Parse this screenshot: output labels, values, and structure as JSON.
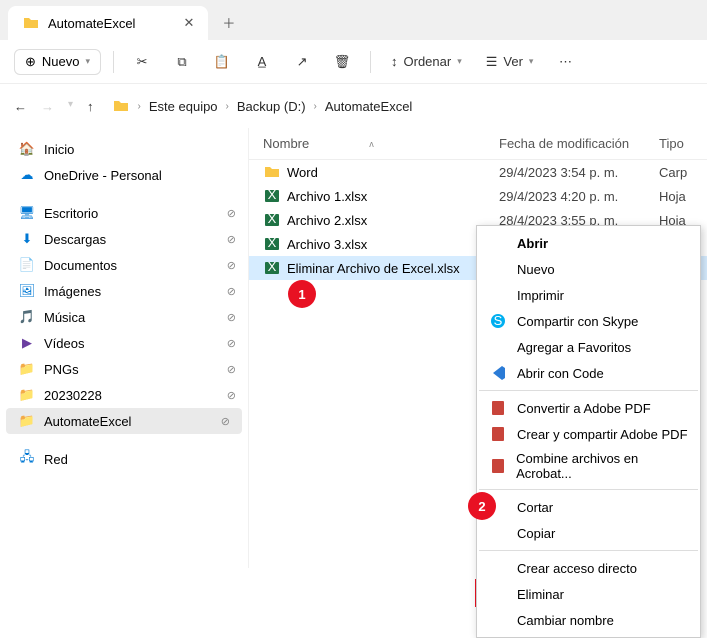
{
  "tab": {
    "title": "AutomateExcel"
  },
  "toolbar": {
    "new": "Nuevo",
    "sort": "Ordenar",
    "view": "Ver"
  },
  "breadcrumb": [
    "Este equipo",
    "Backup (D:)",
    "AutomateExcel"
  ],
  "sidebar": {
    "home": "Inicio",
    "onedrive": "OneDrive - Personal",
    "items": [
      "Escritorio",
      "Descargas",
      "Documentos",
      "Imágenes",
      "Música",
      "Vídeos",
      "PNGs",
      "20230228",
      "AutomateExcel"
    ],
    "network": "Red"
  },
  "columns": {
    "name": "Nombre",
    "date": "Fecha de modificación",
    "type": "Tipo"
  },
  "rows": [
    {
      "name": "Word",
      "date": "29/4/2023 3:54 p. m.",
      "type": "Carp",
      "kind": "folder"
    },
    {
      "name": "Archivo 1.xlsx",
      "date": "29/4/2023 4:20 p. m.",
      "type": "Hoja",
      "kind": "xlsx"
    },
    {
      "name": "Archivo 2.xlsx",
      "date": "28/4/2023 3:55 p. m.",
      "type": "Hoja",
      "kind": "xlsx"
    },
    {
      "name": "Archivo 3.xlsx",
      "date": "",
      "type": "",
      "kind": "xlsx"
    },
    {
      "name": "Eliminar Archivo de Excel.xlsx",
      "date": "",
      "type": "",
      "kind": "xlsx",
      "selected": true
    }
  ],
  "context_menu": [
    {
      "label": "Abrir",
      "bold": true
    },
    {
      "label": "Nuevo"
    },
    {
      "label": "Imprimir"
    },
    {
      "label": "Compartir con Skype",
      "icon": "skype"
    },
    {
      "label": "Agregar a Favoritos"
    },
    {
      "label": "Abrir con Code",
      "icon": "vscode"
    },
    {
      "sep": true
    },
    {
      "label": "Convertir a Adobe PDF",
      "icon": "pdf"
    },
    {
      "label": "Crear y compartir Adobe PDF",
      "icon": "pdf"
    },
    {
      "label": "Combine archivos en Acrobat...",
      "icon": "pdf"
    },
    {
      "sep": true
    },
    {
      "label": "Cortar"
    },
    {
      "label": "Copiar"
    },
    {
      "sep": true
    },
    {
      "label": "Crear acceso directo"
    },
    {
      "label": "Eliminar",
      "annot": true
    },
    {
      "label": "Cambiar nombre"
    }
  ],
  "annotations": {
    "one": "1",
    "two": "2"
  }
}
